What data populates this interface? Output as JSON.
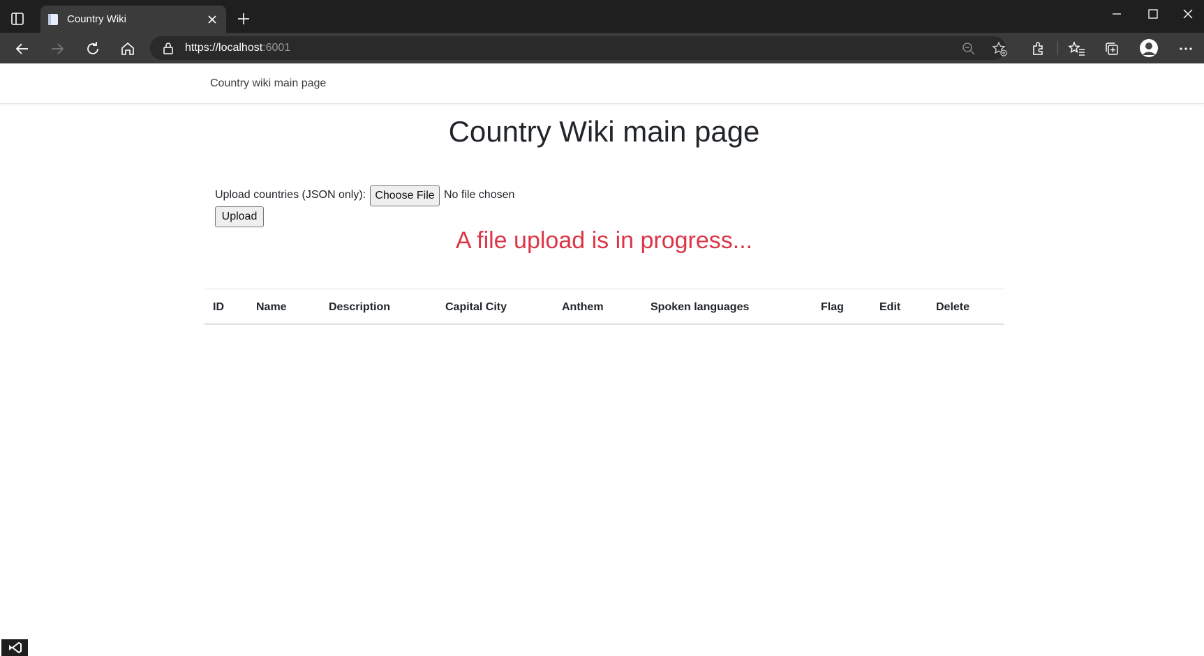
{
  "browser": {
    "tab_title": "Country Wiki",
    "url_host": "https://localhost",
    "url_port": ":6001"
  },
  "page": {
    "nav_brand": "Country wiki main page",
    "title": "Country Wiki main page",
    "upload_label": "Upload countries (JSON only):",
    "choose_file_label": "Choose File",
    "no_file_text": "No file chosen",
    "upload_button_label": "Upload",
    "progress_message": "A file upload is in progress...",
    "progress_color": "#dc3545"
  },
  "table": {
    "headers": [
      "ID",
      "Name",
      "Description",
      "Capital City",
      "Anthem",
      "Spoken languages",
      "Flag",
      "Edit",
      "Delete"
    ]
  },
  "icons": [
    "tab-actions-icon",
    "page-icon",
    "close-icon",
    "plus-icon",
    "minimize-icon",
    "maximize-icon",
    "back-arrow-icon",
    "forward-arrow-icon",
    "refresh-icon",
    "home-icon",
    "lock-icon",
    "zoom-out-icon",
    "add-favorite-icon",
    "extensions-icon",
    "favorites-icon",
    "collections-icon",
    "profile-avatar-icon",
    "more-icon",
    "visual-studio-icon"
  ]
}
